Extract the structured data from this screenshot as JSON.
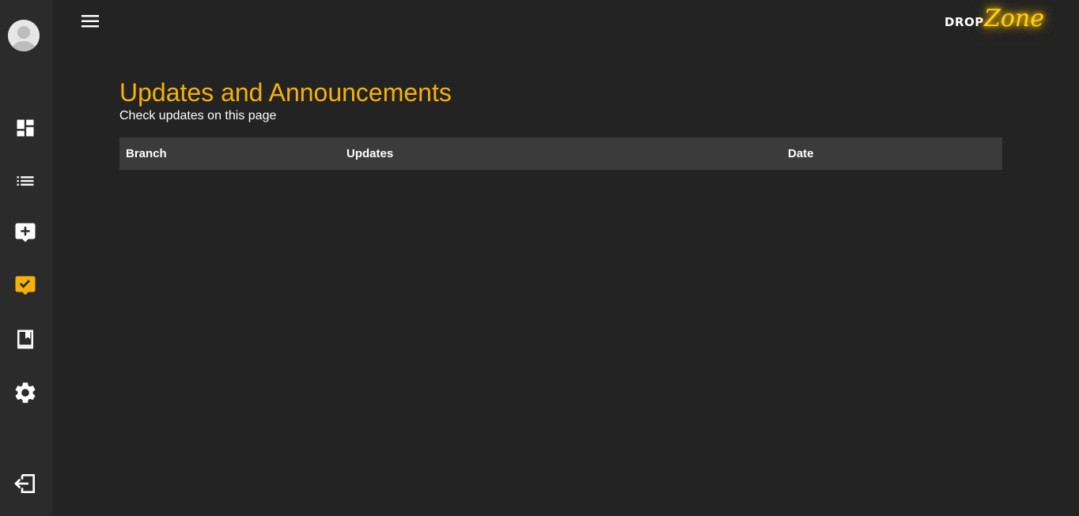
{
  "app": {
    "logo": {
      "part1": "DROP",
      "part2": "Zone"
    }
  },
  "sidebar": {
    "items": [
      {
        "name": "dashboard",
        "icon": "dashboard-icon"
      },
      {
        "name": "list",
        "icon": "list-icon"
      },
      {
        "name": "add-request",
        "icon": "add-comment-icon"
      },
      {
        "name": "updates",
        "icon": "check-comment-icon",
        "active": true
      },
      {
        "name": "guide",
        "icon": "book-icon"
      },
      {
        "name": "settings",
        "icon": "gear-icon"
      },
      {
        "name": "logout",
        "icon": "logout-icon"
      }
    ],
    "active_color": "#f5b10a"
  },
  "main": {
    "title": "Updates and Announcements",
    "subtitle": "Check updates on this page",
    "table": {
      "columns": [
        "Branch",
        "Updates",
        "Date"
      ],
      "rows": []
    }
  },
  "colors": {
    "accent": "#f5b10a",
    "background": "#232323",
    "sidebar": "#2b2b2b",
    "table_header": "#3b3b3b"
  }
}
